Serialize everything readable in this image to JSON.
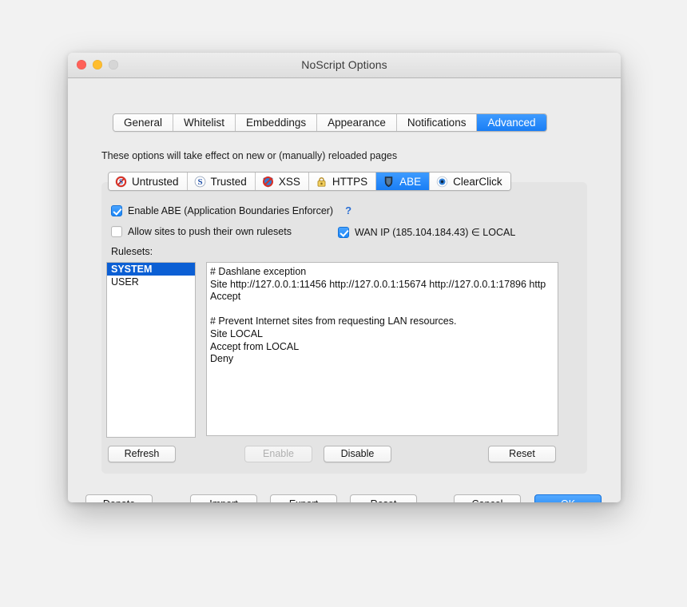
{
  "window": {
    "title": "NoScript Options",
    "traffic_lights": [
      "close-red",
      "minimize-yellow",
      "zoom-gray-disabled"
    ]
  },
  "main_tabs": [
    {
      "label": "General",
      "active": false
    },
    {
      "label": "Whitelist",
      "active": false
    },
    {
      "label": "Embeddings",
      "active": false
    },
    {
      "label": "Appearance",
      "active": false
    },
    {
      "label": "Notifications",
      "active": false
    },
    {
      "label": "Advanced",
      "active": true
    }
  ],
  "hint": "These options will take effect on new or (manually) reloaded pages",
  "sub_tabs": [
    {
      "label": "Untrusted",
      "icon": "noscript-forbidden-red-s-icon",
      "active": false
    },
    {
      "label": "Trusted",
      "icon": "noscript-blue-s-icon",
      "active": false
    },
    {
      "label": "XSS",
      "icon": "xss-crossed-shield-icon",
      "active": false
    },
    {
      "label": "HTTPS",
      "icon": "padlock-icon",
      "active": false
    },
    {
      "label": "ABE",
      "icon": "abe-shield-icon",
      "active": true
    },
    {
      "label": "ClearClick",
      "icon": "eye-target-icon",
      "active": false
    }
  ],
  "abe": {
    "enable_label": "Enable ABE (Application Boundaries Enforcer)",
    "enable_checked": true,
    "help_glyph": "?",
    "allow_push_label": "Allow sites to push their own rulesets",
    "allow_push_checked": false,
    "wan_ip_label": "WAN IP (185.104.184.43) ∈ LOCAL",
    "wan_ip_checked": true,
    "rulesets_label": "Rulesets:",
    "ruleset_list": [
      {
        "name": "SYSTEM",
        "selected": true
      },
      {
        "name": "USER",
        "selected": false
      }
    ],
    "rules_text_lines": [
      "# Dashlane exception",
      "Site http://127.0.0.1:11456 http://127.0.0.1:15674 http://127.0.0.1:17896 http",
      "Accept",
      "",
      "# Prevent Internet sites from requesting LAN resources.",
      "Site LOCAL",
      "Accept from LOCAL",
      "Deny"
    ],
    "buttons": {
      "refresh": "Refresh",
      "enable": "Enable",
      "enable_disabled": true,
      "disable": "Disable",
      "reset": "Reset"
    }
  },
  "bottom_buttons": [
    {
      "id": "donate",
      "label": "Donate",
      "primary": false
    },
    {
      "id": "import",
      "label": "Import",
      "primary": false
    },
    {
      "id": "export",
      "label": "Export",
      "primary": false
    },
    {
      "id": "reset",
      "label": "Reset",
      "primary": false
    },
    {
      "id": "cancel",
      "label": "Cancel",
      "primary": false
    },
    {
      "id": "ok",
      "label": "OK",
      "primary": true
    }
  ],
  "colors": {
    "accent_blue": "#1a7ef5",
    "selection_blue": "#0b5fd4",
    "help_link_blue": "#2b6fd4",
    "window_bg": "#ececec",
    "panel_bg": "#e4e4e4",
    "page_bg": "#f2f2f2"
  }
}
